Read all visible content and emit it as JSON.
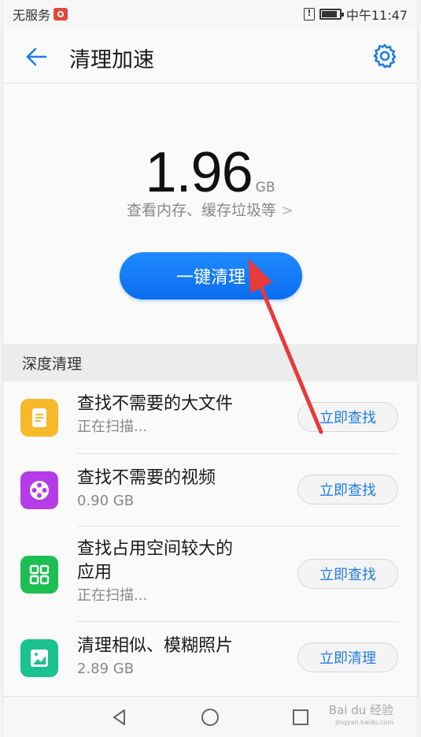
{
  "status_bar": {
    "carrier": "无服务",
    "time": "中午11:47"
  },
  "header": {
    "title": "清理加速",
    "back_icon": "back-arrow-icon",
    "settings_icon": "gear-icon"
  },
  "hero": {
    "amount": "1.96",
    "unit": "GB",
    "view_link": "查看内存、缓存垃圾等",
    "clean_button": "一键清理"
  },
  "section": {
    "title": "深度清理"
  },
  "items": [
    {
      "title": "查找不需要的大文件",
      "subtitle": "正在扫描...",
      "action": "立即查找",
      "icon": "document-icon",
      "color": "#f7b82a"
    },
    {
      "title": "查找不需要的视频",
      "subtitle": "0.90 GB",
      "action": "立即查找",
      "icon": "film-reel-icon",
      "color": "#b53ce8"
    },
    {
      "title_line1": "查找占用空间较大的",
      "title_line2": "应用",
      "subtitle": "正在扫描...",
      "action": "立即查找",
      "icon": "apps-grid-icon",
      "color": "#1dbf52"
    },
    {
      "title": "清理相似、模糊照片",
      "subtitle": "2.89 GB",
      "action": "立即清理",
      "icon": "photo-icon",
      "color": "#19c28f"
    }
  ],
  "watermark": {
    "brand": "Bai du 经验",
    "url": "jingyan.baidu.com"
  },
  "colors": {
    "accent": "#1f7de6",
    "button": "#0f74f5",
    "annotation_arrow": "#e8393b"
  }
}
